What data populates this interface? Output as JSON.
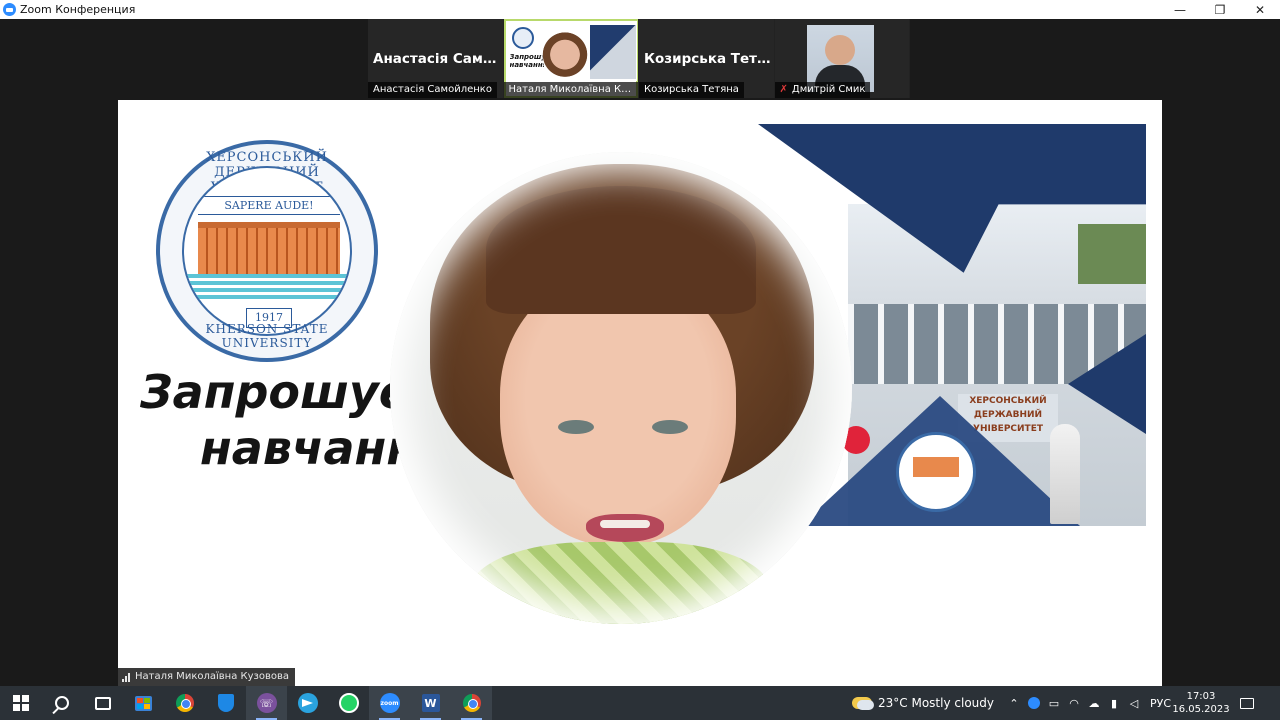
{
  "window": {
    "title": "Zoom Конференция",
    "controls": {
      "minimize": "—",
      "restore": "❐",
      "close": "✕"
    }
  },
  "participants": [
    {
      "display_name": "Анастасія Само...",
      "label": "Анастасія Самойленко",
      "video": false,
      "muted": false
    },
    {
      "display_name": "",
      "label": "Наталя Миколаївна Кузо...",
      "video": true,
      "active_speaker": true,
      "thumb_text": "Запрошуємо навчання",
      "muted": false
    },
    {
      "display_name": "Козирська Тетя...",
      "label": "Козирська Тетяна",
      "video": false,
      "muted": false
    },
    {
      "display_name": "",
      "label": "Дмитрій Смик",
      "video": true,
      "muted": true
    }
  ],
  "share": {
    "seal_top_text": "ХЕРСОНСЬКИЙ ДЕРЖАВНИЙ УНІВЕРСИТЕТ",
    "seal_bottom_text": "KHERSON STATE UNIVERSITY",
    "motto": "SAPERE AUDE!",
    "year": "1917",
    "invite_line1": "Запрошуєм",
    "invite_line2": "навчання",
    "banner_sign_line1": "ХЕРСОНСЬКИЙ",
    "banner_sign_line2": "ДЕРЖАВНИЙ",
    "banner_sign_line3": "УНІВЕРСИТЕТ"
  },
  "speaker_label": "Наталя Миколаївна Кузовова",
  "taskbar": {
    "apps": [
      "windows-start",
      "search",
      "task-view",
      "store",
      "chrome",
      "defender",
      "viber",
      "telegram",
      "whatsapp",
      "zoom",
      "word",
      "chrome-profile"
    ],
    "zoom_icon_text": "zoom",
    "word_icon_text": "W"
  },
  "weather": {
    "temp": "23°C",
    "condition": "Mostly cloudy"
  },
  "tray": {
    "language": "РУС",
    "time": "17:03",
    "date": "16.05.2023"
  },
  "colors": {
    "accent": "#2d8cff",
    "active_outline": "#b8d96b",
    "navy": "#1f3a6b"
  }
}
